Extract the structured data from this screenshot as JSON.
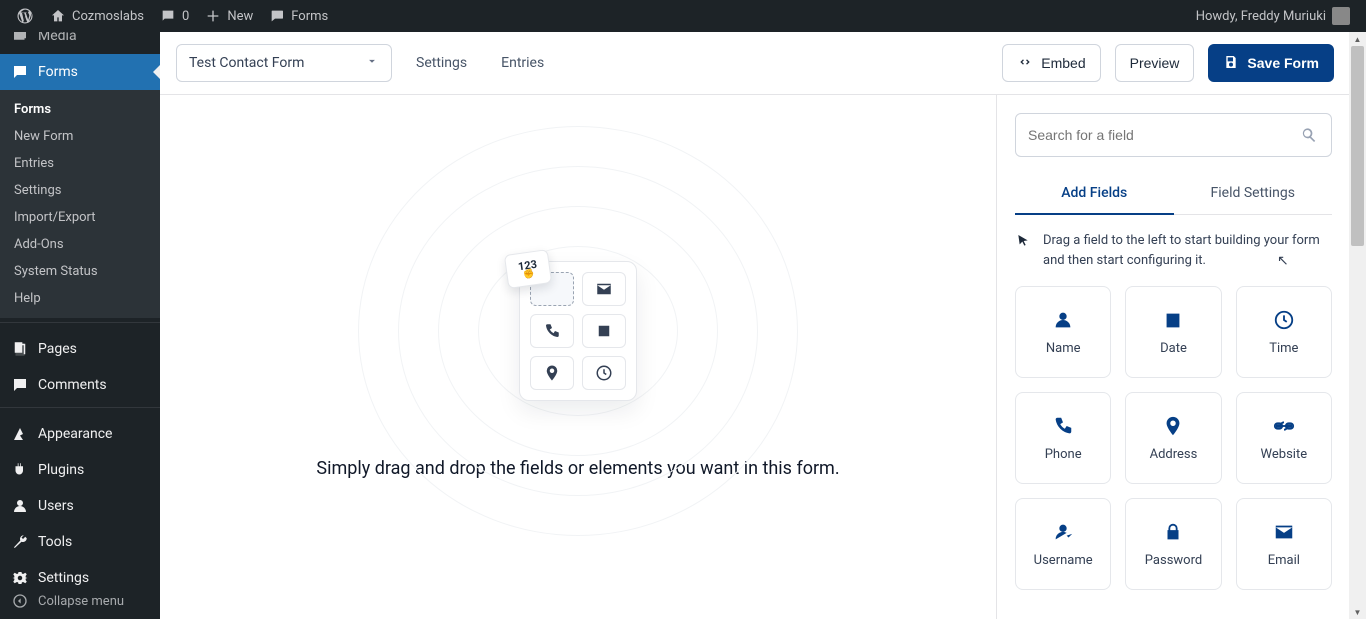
{
  "adminbar": {
    "site": "Cozmoslabs",
    "comments": "0",
    "new": "New",
    "forms": "Forms",
    "howdy": "Howdy, Freddy Muriuki"
  },
  "sidebar": {
    "media": "Media",
    "forms": "Forms",
    "submenu": [
      "Forms",
      "New Form",
      "Entries",
      "Settings",
      "Import/Export",
      "Add-Ons",
      "System Status",
      "Help"
    ],
    "pages": "Pages",
    "comments": "Comments",
    "appearance": "Appearance",
    "plugins": "Plugins",
    "users": "Users",
    "tools": "Tools",
    "settings": "Settings",
    "collapse": "Collapse menu"
  },
  "topbar": {
    "form_name": "Test Contact Form",
    "settings": "Settings",
    "entries": "Entries",
    "embed": "Embed",
    "preview": "Preview",
    "save": "Save Form"
  },
  "canvas": {
    "chip": "123",
    "message": "Simply drag and drop the fields or elements you want in this form."
  },
  "panel": {
    "search_placeholder": "Search for a field",
    "tab_add": "Add Fields",
    "tab_settings": "Field Settings",
    "hint": "Drag a field to the left to start building your form and then start configuring it.",
    "fields": [
      {
        "label": "Name",
        "icon": "user"
      },
      {
        "label": "Date",
        "icon": "date"
      },
      {
        "label": "Time",
        "icon": "time"
      },
      {
        "label": "Phone",
        "icon": "phone"
      },
      {
        "label": "Address",
        "icon": "address"
      },
      {
        "label": "Website",
        "icon": "website"
      },
      {
        "label": "Username",
        "icon": "username"
      },
      {
        "label": "Password",
        "icon": "password"
      },
      {
        "label": "Email",
        "icon": "email"
      }
    ]
  }
}
